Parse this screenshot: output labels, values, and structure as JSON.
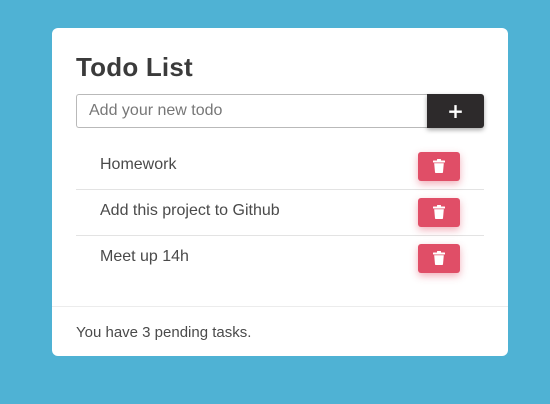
{
  "card": {
    "title": "Todo List",
    "input": {
      "placeholder": "Add your new todo",
      "value": ""
    },
    "add_button_label": "+",
    "todos": [
      {
        "text": "Homework",
        "delete_icon": "trash-icon"
      },
      {
        "text": "Add this project to Github",
        "delete_icon": "trash-icon"
      },
      {
        "text": "Meet up 14h",
        "delete_icon": "trash-icon"
      }
    ],
    "footer": "You have 3 pending tasks."
  },
  "colors": {
    "background": "#4fb2d4",
    "card": "#ffffff",
    "add_button": "#2d2a2b",
    "delete_button": "#e04e67",
    "text": "#4a4a4a"
  }
}
